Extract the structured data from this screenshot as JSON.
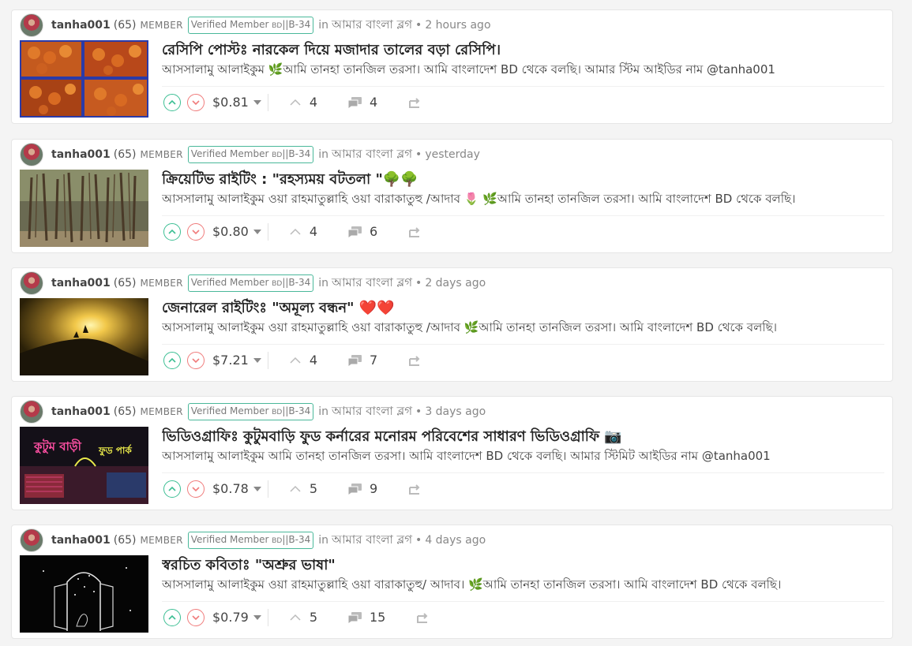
{
  "posts": [
    {
      "author": "tanha001",
      "reputation": "(65)",
      "role": "MEMBER",
      "badge_main": "Verified Member ",
      "badge_small": "BD",
      "badge_tail": "||B-34",
      "in_word": "in",
      "community": "আমার বাংলা ব্লগ",
      "dot": "•",
      "time": "2 hours ago",
      "title": "রেসিপি পোস্টঃ নারকেল দিয়ে মজাদার তালের বড়া রেসিপি।",
      "summary": "আসসালামু আলাইকুম 🌿আমি তানহা তানজিল তরসা। আমি বাংলাদেশ BD থেকে বলছি। আমার স্টিম আইডির নাম @tanha001",
      "payout": "$0.81",
      "votes": "4",
      "comments": "4"
    },
    {
      "author": "tanha001",
      "reputation": "(65)",
      "role": "MEMBER",
      "badge_main": "Verified Member ",
      "badge_small": "BD",
      "badge_tail": "||B-34",
      "in_word": "in",
      "community": "আমার বাংলা ব্লগ",
      "dot": "•",
      "time": "yesterday",
      "title": "ক্রিয়েটিভ রাইটিং : \"রহস্যময় বটতলা \"🌳🌳",
      "summary": "আসসালামু আলাইকুম ওয়া রাহমাতুল্লাহি ওয়া বারাকাতুহু /আদাব 🌷 🌿আমি তানহা তানজিল তরসা। আমি বাংলাদেশ BD থেকে বলছি।",
      "payout": "$0.80",
      "votes": "4",
      "comments": "6"
    },
    {
      "author": "tanha001",
      "reputation": "(65)",
      "role": "MEMBER",
      "badge_main": "Verified Member ",
      "badge_small": "BD",
      "badge_tail": "||B-34",
      "in_word": "in",
      "community": "আমার বাংলা ব্লগ",
      "dot": "•",
      "time": "2 days ago",
      "title": "জেনারেল রাইটিংঃ \"অমূল্য বন্ধন\" ❤️❤️",
      "summary": "আসসালামু আলাইকুম ওয়া রাহমাতুল্লাহি ওয়া বারাকাতুহু /আদাব 🌿আমি তানহা তানজিল তরসা। আমি বাংলাদেশ BD থেকে বলছি।",
      "payout": "$7.21",
      "votes": "4",
      "comments": "7"
    },
    {
      "author": "tanha001",
      "reputation": "(65)",
      "role": "MEMBER",
      "badge_main": "Verified Member ",
      "badge_small": "BD",
      "badge_tail": "||B-34",
      "in_word": "in",
      "community": "আমার বাংলা ব্লগ",
      "dot": "•",
      "time": "3 days ago",
      "title": "ভিডিওগ্রাফিঃ কুটুমবাড়ি ফুড কর্নারের মনোরম পরিবেশের সাধারণ ভিডিওগ্রাফি 📷",
      "summary": "আসসালামু আলাইকুম আমি তানহা তানজিল তরসা। আমি বাংলাদেশ BD থেকে বলছি। আমার স্টিমিট আইডির নাম @tanha001",
      "payout": "$0.78",
      "votes": "5",
      "comments": "9"
    },
    {
      "author": "tanha001",
      "reputation": "(65)",
      "role": "MEMBER",
      "badge_main": "Verified Member ",
      "badge_small": "BD",
      "badge_tail": "||B-34",
      "in_word": "in",
      "community": "আমার বাংলা ব্লগ",
      "dot": "•",
      "time": "4 days ago",
      "title": "স্বরচিত কবিতাঃ \"অশ্রুর ভাষা\"",
      "summary": "আসসালামু আলাইকুম ওয়া রাহমাতুল্লাহি ওয়া বারাকাতুহু/ আদাব। 🌿আমি তানহা তানজিল তরসা। আমি বাংলাদেশ BD থেকে বলছি।",
      "payout": "$0.79",
      "votes": "5",
      "comments": "15"
    }
  ],
  "icons": {
    "upvote": "chevron-up-circle-icon",
    "downvote": "chevron-down-circle-icon",
    "votes": "chevron-up-icon",
    "comments": "comments-icon",
    "reblog": "reblog-icon"
  },
  "colors": {
    "upvote": "#3dbf94",
    "downvote": "#f07c7c",
    "badge_border": "#4ab89a",
    "background": "#f4f4f4"
  }
}
